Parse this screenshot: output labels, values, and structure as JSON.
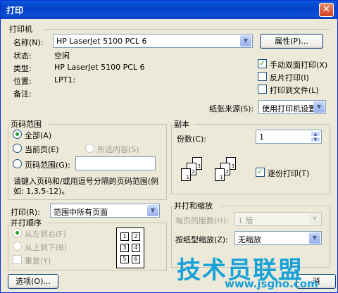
{
  "window": {
    "title": "打印",
    "close": "✕"
  },
  "printer": {
    "group_title": "打印机",
    "name_label": "名称(N):",
    "name_value": "HP LaserJet 5100 PCL 6",
    "properties_button": "属性(P)...",
    "status_label": "状态:",
    "status_value": "空闲",
    "type_label": "类型:",
    "type_value": "HP LaserJet 5100 PCL 6",
    "where_label": "位置:",
    "where_value": "LPT1:",
    "comment_label": "备注:",
    "manual_duplex_label": "手动双面打印(X)",
    "manual_duplex_checked": true,
    "reverse_label": "反片打印(I)",
    "print_to_file_label": "打印到文件(L)",
    "paper_source_label": "纸张来源(S):",
    "paper_source_value": "使用打印机设置"
  },
  "page_range": {
    "group_title": "页码范围",
    "all_label": "全部(A)",
    "current_label": "当前页(E)",
    "selection_label": "所选内容(S)",
    "pages_label": "页码范围(G):",
    "pages_value": "",
    "hint": "请键入页码和/或用逗号分隔的页码范围(例如: 1,3,5-12)。",
    "print_what_label": "打印(R):",
    "print_what_value": "范围中所有页面"
  },
  "copies": {
    "group_title": "副本",
    "count_label": "份数(C):",
    "count_value": "1",
    "collate_label": "逐份打印(T)",
    "collate_checked": true
  },
  "duplex_order": {
    "group_title": "并打顺序",
    "left_to_right": "从左到右(F)",
    "top_to_bottom": "从上到下(B)",
    "repeat": "重复(Y)",
    "layout_cells": [
      "1",
      "2",
      "3",
      "4",
      "5",
      "6"
    ]
  },
  "zoom": {
    "group_title": "并打和缩放",
    "pages_per_sheet_label": "每页的版数(H):",
    "pages_per_sheet_value": "1 版",
    "scale_label": "按纸型缩放(Z):",
    "scale_value": "无缩放"
  },
  "footer": {
    "options_button": "选项(O)...",
    "tail": "消"
  },
  "watermark": {
    "text": "技术员联盟",
    "url": "www.jsgho.com"
  }
}
